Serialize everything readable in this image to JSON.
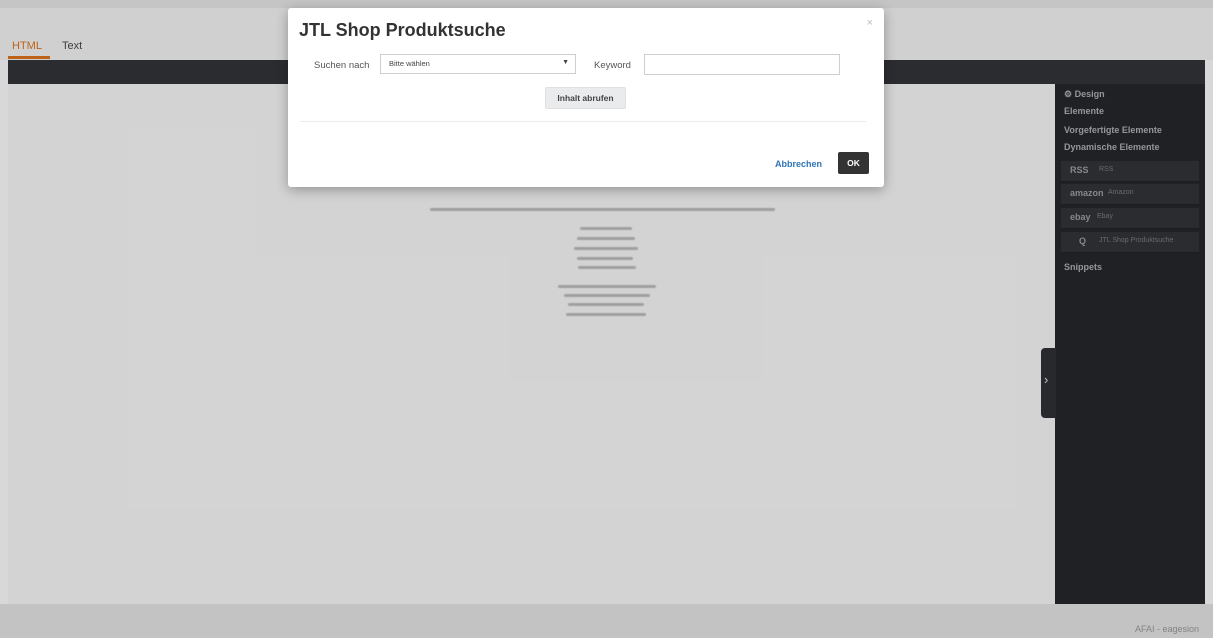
{
  "editor": {
    "tabs": [
      {
        "label": "HTML",
        "active": true
      },
      {
        "label": "Text",
        "active": false
      }
    ],
    "accent_color": "#c96a1a"
  },
  "sidebar": {
    "design_label": "Design",
    "elements_label": "Elemente",
    "prefab_label": "Vorgefertigte Elemente",
    "dynamic_label": "Dynamische Elemente",
    "dynamic_items": [
      {
        "logo": "RSS",
        "label": "RSS",
        "icon": "rss-icon"
      },
      {
        "logo": "amazon",
        "label": "Amazon",
        "icon": "amazon-logo-icon"
      },
      {
        "logo": "ebay",
        "label": "Ebay",
        "icon": "ebay-logo-icon"
      },
      {
        "logo": "Q",
        "label": "JTL Shop Produktsuche",
        "icon": "search-icon"
      }
    ],
    "snippets_label": "Snippets",
    "toggle_icon": "chevron-right-icon"
  },
  "modal": {
    "title": "JTL Shop Produktsuche",
    "close_glyph": "×",
    "search_by_label": "Suchen nach",
    "select_value": "Bitte wählen",
    "keyword_label": "Keyword",
    "keyword_value": "",
    "fetch_button": "Inhalt abrufen",
    "cancel_button": "Abbrechen",
    "ok_button": "OK"
  },
  "footer": {
    "text": "AFAI - eagesion"
  }
}
